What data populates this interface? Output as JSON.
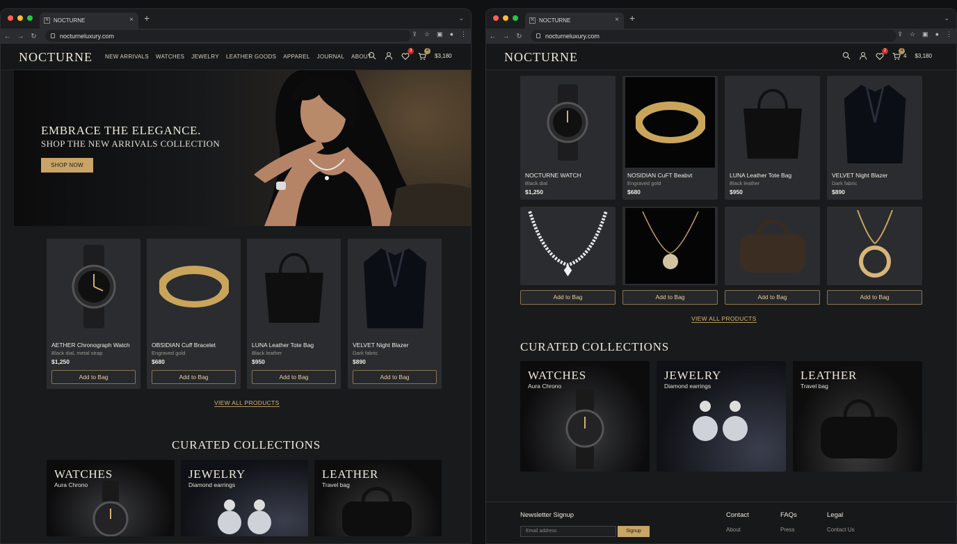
{
  "browser": {
    "tab_title": "NOCTURNE",
    "tab_favicon": "N",
    "url": "nocturneluxury.com"
  },
  "site": {
    "logo": "NOCTURNE",
    "menu": [
      "NEW ARRIVALS",
      "WATCHES",
      "JEWELRY",
      "LEATHER GOODS",
      "APPAREL",
      "JOURNAL",
      "ABOUT"
    ],
    "wishlist_count": "3",
    "cart_count": "4",
    "cart_total": "$3,180",
    "right_wishlist_count": "2",
    "right_cart_label": "4",
    "right_cart_total": "$3,180"
  },
  "hero": {
    "headline": "EMBRACE THE ELEGANCE.",
    "subheadline": "SHOP THE NEW ARRIVALS COLLECTION",
    "cta": "SHOP NOW"
  },
  "products_left": [
    {
      "name": "AETHER Chronograph Watch",
      "desc": "Black dial, metal strap",
      "price": "$1,250",
      "button": "Add to Bag",
      "icon": "watch-icon"
    },
    {
      "name": "OBSIDIAN Cuff Bracelet",
      "desc": "Engraved gold",
      "price": "$680",
      "button": "Add to Bag",
      "icon": "bracelet-icon"
    },
    {
      "name": "LUNA Leather Tote Bag",
      "desc": "Black leather",
      "price": "$950",
      "button": "Add to Bag",
      "icon": "tote-bag-icon"
    },
    {
      "name": "VELVET Night Blazer",
      "desc": "Dark fabric",
      "price": "$890",
      "button": "Add to Bag",
      "icon": "blazer-icon"
    }
  ],
  "products_right_row1": [
    {
      "name": "NOCTURNE WATCH",
      "desc": "Black dial",
      "price": "$1,250",
      "icon": "watch-icon"
    },
    {
      "name": "NOSIDIAN CuFT Beabvt",
      "desc": "Engraved gold",
      "price": "$680",
      "icon": "bracelet-icon"
    },
    {
      "name": "LUNA Leather Tote Bag",
      "desc": "Black leather",
      "price": "$950",
      "icon": "tote-bag-icon"
    },
    {
      "name": "VELVET Night Blazer",
      "desc": "Dark fabric",
      "price": "$890",
      "icon": "blazer-icon"
    }
  ],
  "products_right_row2": [
    {
      "button": "Add to Bag",
      "icon": "diamond-necklace-icon"
    },
    {
      "button": "Add to Bag",
      "icon": "pendant-necklace-icon"
    },
    {
      "button": "Add to Bag",
      "icon": "duffel-bag-icon"
    },
    {
      "button": "Add to Bag",
      "icon": "gold-pendant-icon"
    }
  ],
  "view_all": "VIEW ALL PRODUCTS",
  "view_all_right": "VIEW ALL PRODUCTS",
  "curated_title": "CURATED COLLECTIONS",
  "collections": [
    {
      "title": "WATCHES",
      "sub": "Aura Chrono",
      "icon": "watch-icon"
    },
    {
      "title": "JEWELRY",
      "sub": "Diamond earrings",
      "icon": "earrings-icon"
    },
    {
      "title": "LEATHER",
      "sub": "Travel bag",
      "icon": "travel-bag-icon"
    }
  ],
  "footer": {
    "newsletter": "Newsletter Signup",
    "email_placeholder": "Email address",
    "signup": "Signup",
    "cols": [
      {
        "title": "Contact",
        "link": "About"
      },
      {
        "title": "FAQs",
        "link": "Press"
      },
      {
        "title": "Legal",
        "link": "Contact Us"
      }
    ]
  },
  "colors": {
    "accent": "#c8a567",
    "background": "#191a1b",
    "card": "#2a2c2f",
    "badge_red": "#c8302a"
  }
}
